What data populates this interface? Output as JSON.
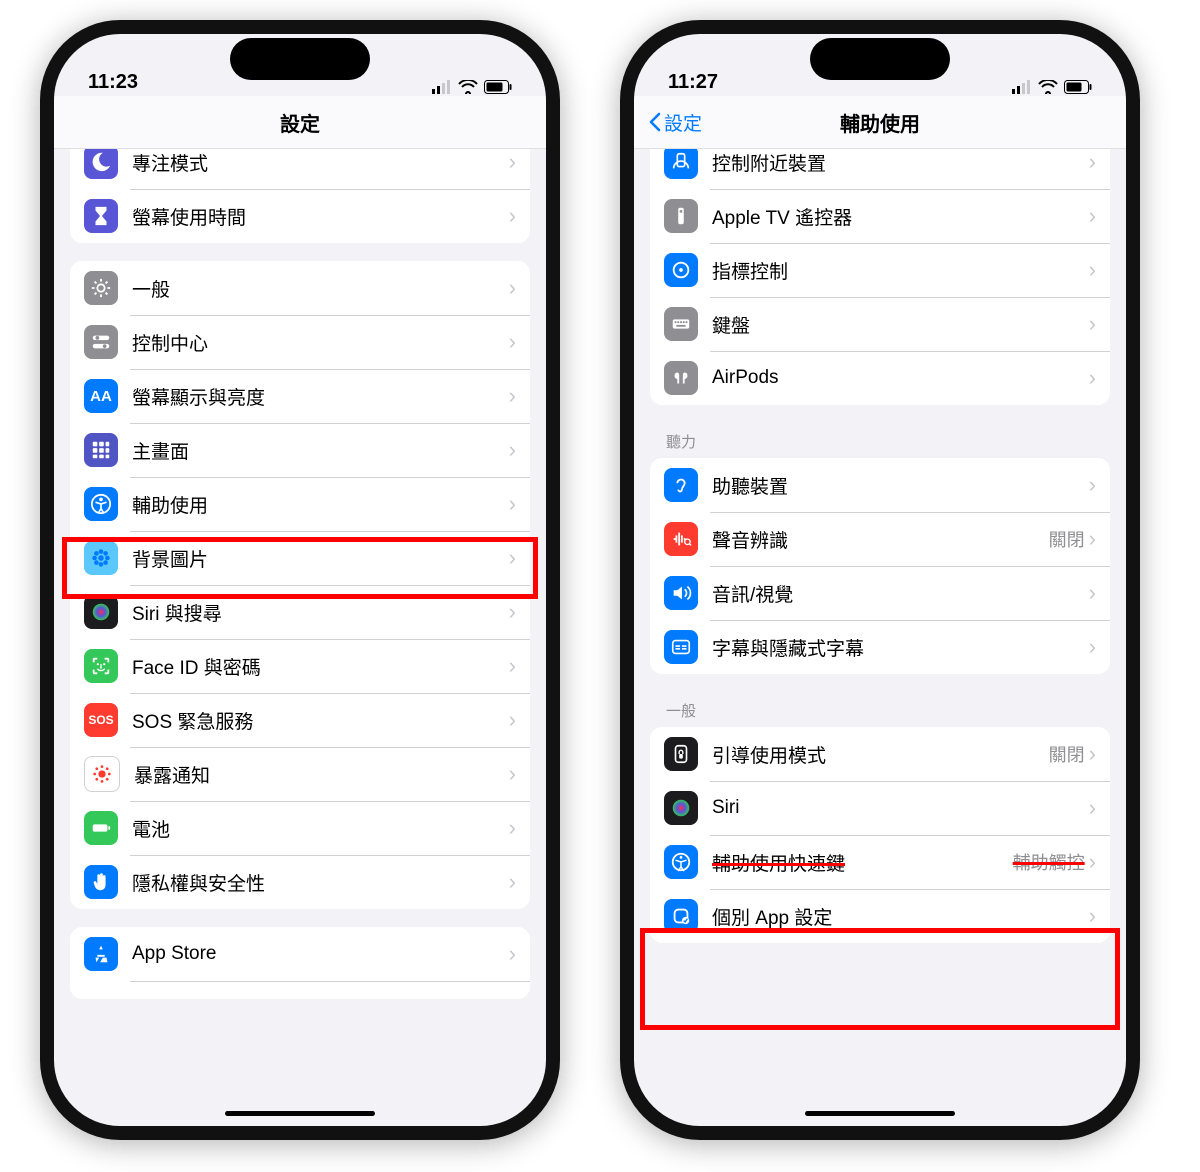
{
  "left": {
    "time": "11:23",
    "title": "設定",
    "rows_g1": [
      {
        "label": "專注模式",
        "icon": "moon",
        "bg": "#5856d6"
      },
      {
        "label": "螢幕使用時間",
        "icon": "hourglass",
        "bg": "#5856d6"
      }
    ],
    "rows_g2": [
      {
        "label": "一般",
        "icon": "gear",
        "bg": "#8e8e93"
      },
      {
        "label": "控制中心",
        "icon": "switches",
        "bg": "#8e8e93"
      },
      {
        "label": "螢幕顯示與亮度",
        "icon": "AA",
        "bg": "#007aff"
      },
      {
        "label": "主畫面",
        "icon": "grid",
        "bg": "#5155c3"
      },
      {
        "label": "輔助使用",
        "icon": "person",
        "bg": "#007aff"
      },
      {
        "label": "背景圖片",
        "icon": "flower",
        "bg": "#4fc3e8"
      },
      {
        "label": "Siri 與搜尋",
        "icon": "siri",
        "bg": "#1c1c1e"
      },
      {
        "label": "Face ID 與密碼",
        "icon": "face",
        "bg": "#34c759"
      },
      {
        "label": "SOS 緊急服務",
        "icon": "SOS",
        "bg": "#ff3b30"
      },
      {
        "label": "暴露通知",
        "icon": "covid",
        "bg": "#ffffff"
      },
      {
        "label": "電池",
        "icon": "battery",
        "bg": "#34c759"
      },
      {
        "label": "隱私權與安全性",
        "icon": "hand",
        "bg": "#007aff"
      }
    ],
    "rows_g3": [
      {
        "label": "App Store",
        "icon": "appstore",
        "bg": "#007aff"
      }
    ]
  },
  "right": {
    "time": "11:27",
    "back": "設定",
    "title": "輔助使用",
    "rows_g1": [
      {
        "label": "控制附近裝置",
        "icon": "nearby",
        "bg": "#007aff"
      },
      {
        "label": "Apple TV 遙控器",
        "icon": "remote",
        "bg": "#8e8e93"
      },
      {
        "label": "指標控制",
        "icon": "pointer",
        "bg": "#007aff"
      },
      {
        "label": "鍵盤",
        "icon": "keyboard",
        "bg": "#8e8e93"
      },
      {
        "label": "AirPods",
        "icon": "airpods",
        "bg": "#8e8e93"
      }
    ],
    "header_h": "聽力",
    "rows_g2": [
      {
        "label": "助聽裝置",
        "icon": "ear",
        "bg": "#007aff"
      },
      {
        "label": "聲音辨識",
        "icon": "sound",
        "bg": "#ff3b30",
        "value": "關閉"
      },
      {
        "label": "音訊/視覺",
        "icon": "speaker",
        "bg": "#007aff"
      },
      {
        "label": "字幕與隱藏式字幕",
        "icon": "cc",
        "bg": "#007aff"
      }
    ],
    "header_g": "一般",
    "rows_g3": [
      {
        "label": "引導使用模式",
        "icon": "guide",
        "bg": "#1c1c1e",
        "value": "關閉"
      },
      {
        "label": "Siri",
        "icon": "siri",
        "bg": "#1c1c1e"
      },
      {
        "label": "輔助使用快速鍵",
        "icon": "shortcut",
        "bg": "#007aff",
        "value": "輔助觸控"
      },
      {
        "label": "個別 App 設定",
        "icon": "perapp",
        "bg": "#007aff"
      }
    ]
  }
}
